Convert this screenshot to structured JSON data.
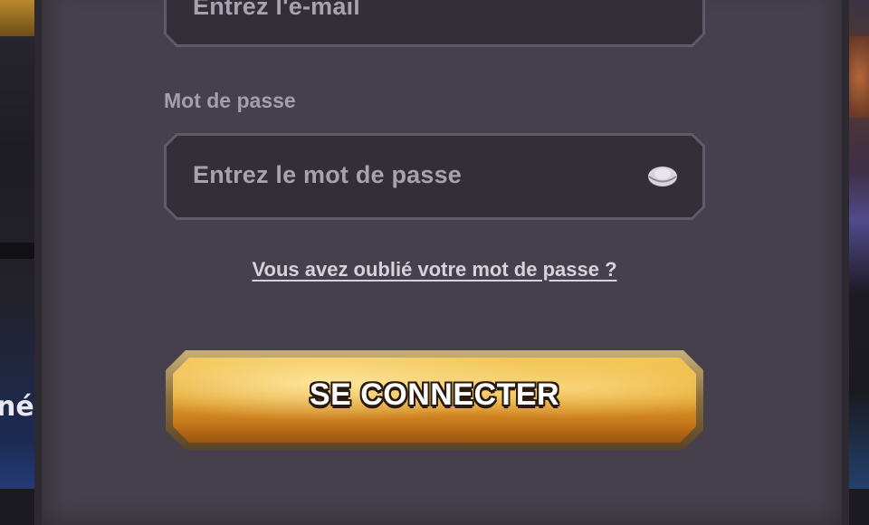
{
  "email_field": {
    "placeholder": "Entrez l'e-mail"
  },
  "password_field": {
    "label": "Mot de passe",
    "placeholder": "Entrez le mot de passe",
    "toggle_icon": "eye-icon"
  },
  "forgot_password_link": "Vous avez oublié votre mot de passe ?",
  "login_button": {
    "label": "SE CONNECTER",
    "color": "#e6a62d"
  },
  "background_edge_text": "né",
  "colors": {
    "panel": "#45404b",
    "field": "#332f38",
    "placeholder": "#a8a2ae",
    "link": "#d6d2dc"
  }
}
